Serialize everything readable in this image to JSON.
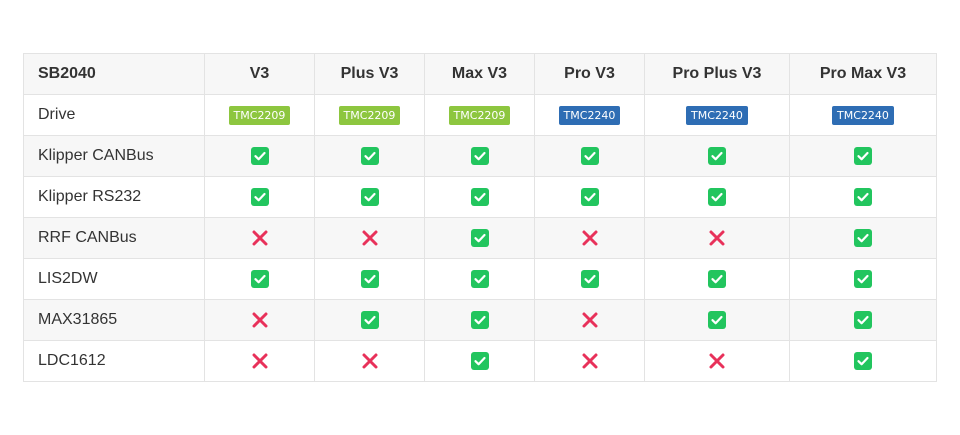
{
  "table": {
    "corner_label": "SB2040",
    "columns": [
      "V3",
      "Plus V3",
      "Max V3",
      "Pro V3",
      "Pro Plus V3",
      "Pro Max V3"
    ],
    "rows": [
      {
        "label": "Drive",
        "badges": [
          "TMC2209",
          "TMC2209",
          "TMC2209",
          "TMC2240",
          "TMC2240",
          "TMC2240"
        ]
      },
      {
        "label": "Klipper CANBus",
        "support": [
          true,
          true,
          true,
          true,
          true,
          true
        ]
      },
      {
        "label": "Klipper RS232",
        "support": [
          true,
          true,
          true,
          true,
          true,
          true
        ]
      },
      {
        "label": "RRF CANBus",
        "support": [
          false,
          false,
          true,
          false,
          false,
          true
        ]
      },
      {
        "label": "LIS2DW",
        "support": [
          true,
          true,
          true,
          true,
          true,
          true
        ]
      },
      {
        "label": "MAX31865",
        "support": [
          false,
          true,
          true,
          false,
          true,
          true
        ]
      },
      {
        "label": "LDC1612",
        "support": [
          false,
          false,
          true,
          false,
          false,
          true
        ]
      }
    ]
  },
  "colors": {
    "check": "#22c55e",
    "cross": "#e8315a",
    "badge_tmc2209": "#8dc63f",
    "badge_tmc2240": "#2e6db4"
  },
  "icons": {
    "supported": "check-square-icon",
    "unsupported": "cross-icon"
  }
}
